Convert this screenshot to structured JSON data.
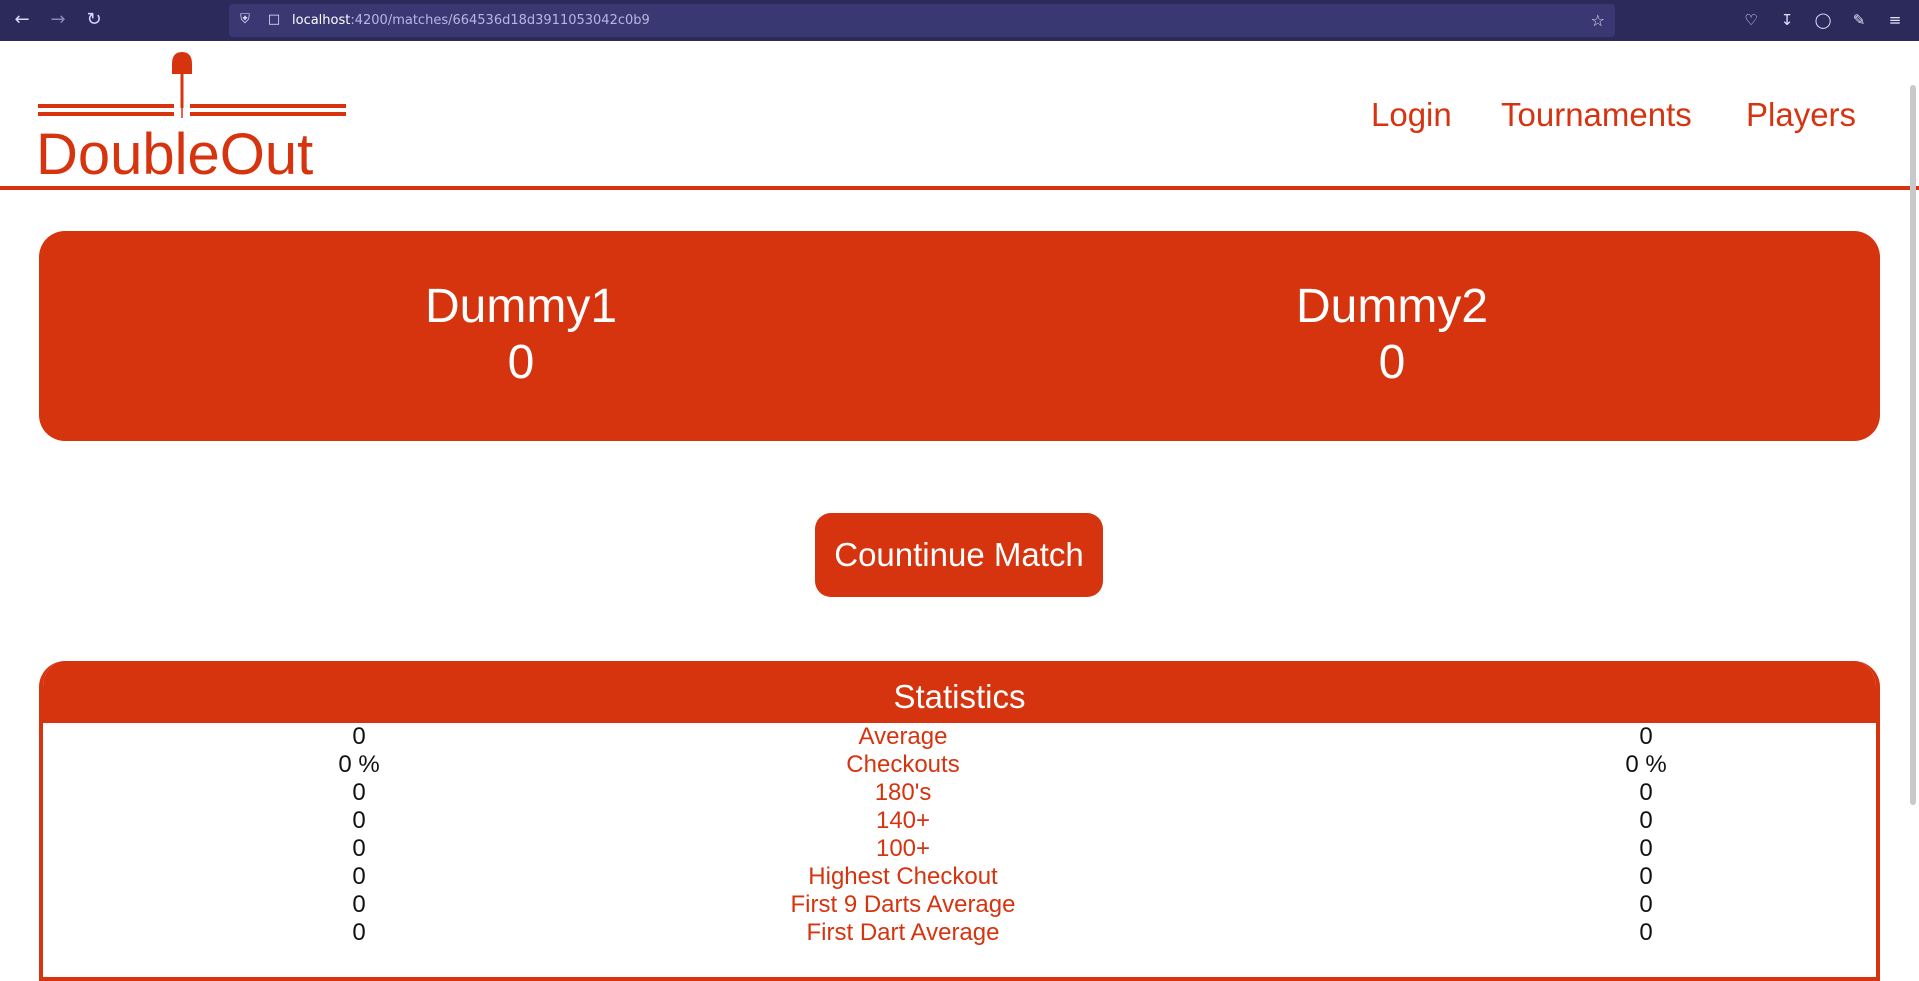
{
  "browser": {
    "url_host": "localhost",
    "url_path": ":4200/matches/664536d18d3911053042c0b9",
    "icons": {
      "back": "back-arrow-icon",
      "forward": "forward-arrow-icon",
      "reload": "reload-icon",
      "shield": "shield-icon",
      "page": "page-icon",
      "bookmark": "star-icon",
      "pocket": "pocket-icon",
      "download": "download-icon",
      "account": "account-icon",
      "extensions": "extensions-icon",
      "menu": "hamburger-menu-icon"
    }
  },
  "header": {
    "logo_text": "DoubleOut",
    "nav": {
      "login": "Login",
      "tournaments": "Tournaments",
      "players": "Players"
    }
  },
  "colors": {
    "brand": "#d6340f",
    "chrome": "#2b2a5a",
    "text": "#111111"
  },
  "match": {
    "player1": {
      "name": "Dummy1",
      "score": "0"
    },
    "player2": {
      "name": "Dummy2",
      "score": "0"
    }
  },
  "actions": {
    "continue_label": "Countinue Match"
  },
  "statistics": {
    "title": "Statistics",
    "rows": [
      {
        "p1": "0",
        "label": "Average",
        "p2": "0"
      },
      {
        "p1": "0 %",
        "label": "Checkouts",
        "p2": "0 %"
      },
      {
        "p1": "0",
        "label": "180's",
        "p2": "0"
      },
      {
        "p1": "0",
        "label": "140+",
        "p2": "0"
      },
      {
        "p1": "0",
        "label": "100+",
        "p2": "0"
      },
      {
        "p1": "0",
        "label": "Highest Checkout",
        "p2": "0"
      },
      {
        "p1": "0",
        "label": "First 9 Darts Average",
        "p2": "0"
      },
      {
        "p1": "0",
        "label": "First Dart Average",
        "p2": "0"
      }
    ]
  }
}
